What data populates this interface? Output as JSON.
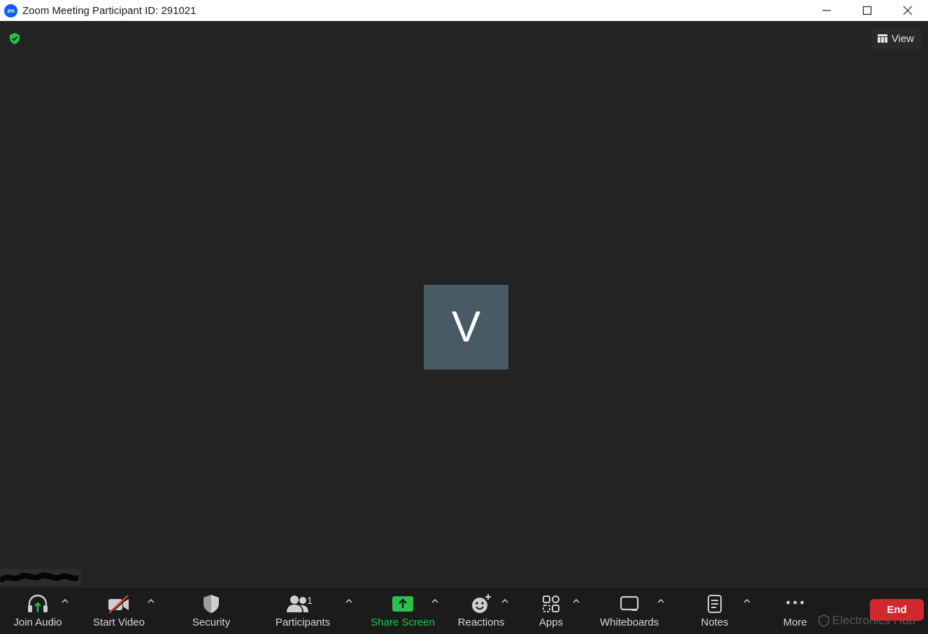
{
  "window": {
    "logo_text": "zm",
    "title": "Zoom Meeting Participant ID: 291021"
  },
  "meeting": {
    "view_label": "View",
    "avatar_initial": "V"
  },
  "toolbar": {
    "join_audio": "Join Audio",
    "start_video": "Start Video",
    "security": "Security",
    "participants": "Participants",
    "participants_count": "1",
    "share_screen": "Share Screen",
    "reactions": "Reactions",
    "apps": "Apps",
    "whiteboards": "Whiteboards",
    "notes": "Notes",
    "more": "More",
    "end": "End"
  },
  "watermark": "Electronics Hub",
  "colors": {
    "accent_green": "#27c24c",
    "end_red": "#d1282d",
    "avatar_bg": "#475a66",
    "zoom_blue": "#0b5cff"
  }
}
